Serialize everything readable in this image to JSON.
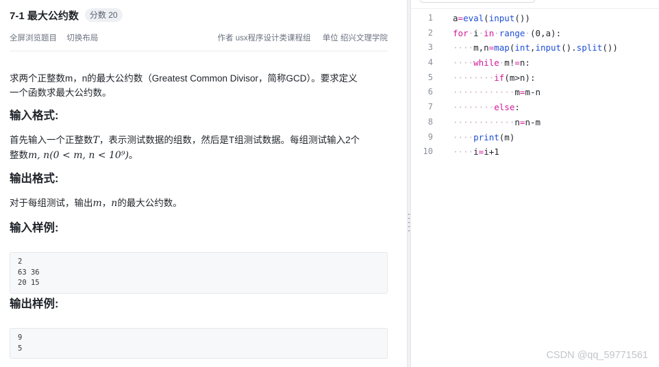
{
  "problem": {
    "title": "7-1 最大公约数",
    "score_label": "分数 20",
    "toolbar": {
      "fullscreen": "全屏浏览题目",
      "switch_layout": "切换布局",
      "author": "作者 usx程序设计类课程组",
      "unit": "单位 绍兴文理学院"
    },
    "description_line1": "求两个正整数m，n的最大公约数（Greatest Common Divisor，简称GCD）。要求定义",
    "description_line2": "一个函数求最大公约数。",
    "input_heading": "输入格式:",
    "input_text_a": "首先输入一个正整数",
    "input_var_T": "T",
    "input_text_b": "，表示测试数据的组数，然后是T组测试数据。每组测试输入2个",
    "input_text_c": "整数",
    "input_math": "m, n(0 < m, n < 10⁹)",
    "input_text_d": "。",
    "output_heading": "输出格式:",
    "output_text_a": "对于每组测试，输出",
    "output_var_m": "m",
    "output_text_b": "，",
    "output_var_n": "n",
    "output_text_c": "的最大公约数。",
    "sample_input_heading": "输入样例:",
    "sample_input": "2\n63 36\n20 15",
    "sample_output_heading": "输出样例:",
    "sample_output": "9\n5"
  },
  "editor": {
    "line_numbers": [
      "1",
      "2",
      "3",
      "4",
      "5",
      "6",
      "7",
      "8",
      "9",
      "10"
    ],
    "lines": [
      "a=eval(input())",
      "for i in range (0,a):",
      "    m,n=map(int,input().split())",
      "    while m!=n:",
      "        if(m>n):",
      "            m=m-n",
      "        else:",
      "            n=n-m",
      "    print(m)",
      "    i=i+1"
    ]
  },
  "watermark": "CSDN @qq_59771561"
}
